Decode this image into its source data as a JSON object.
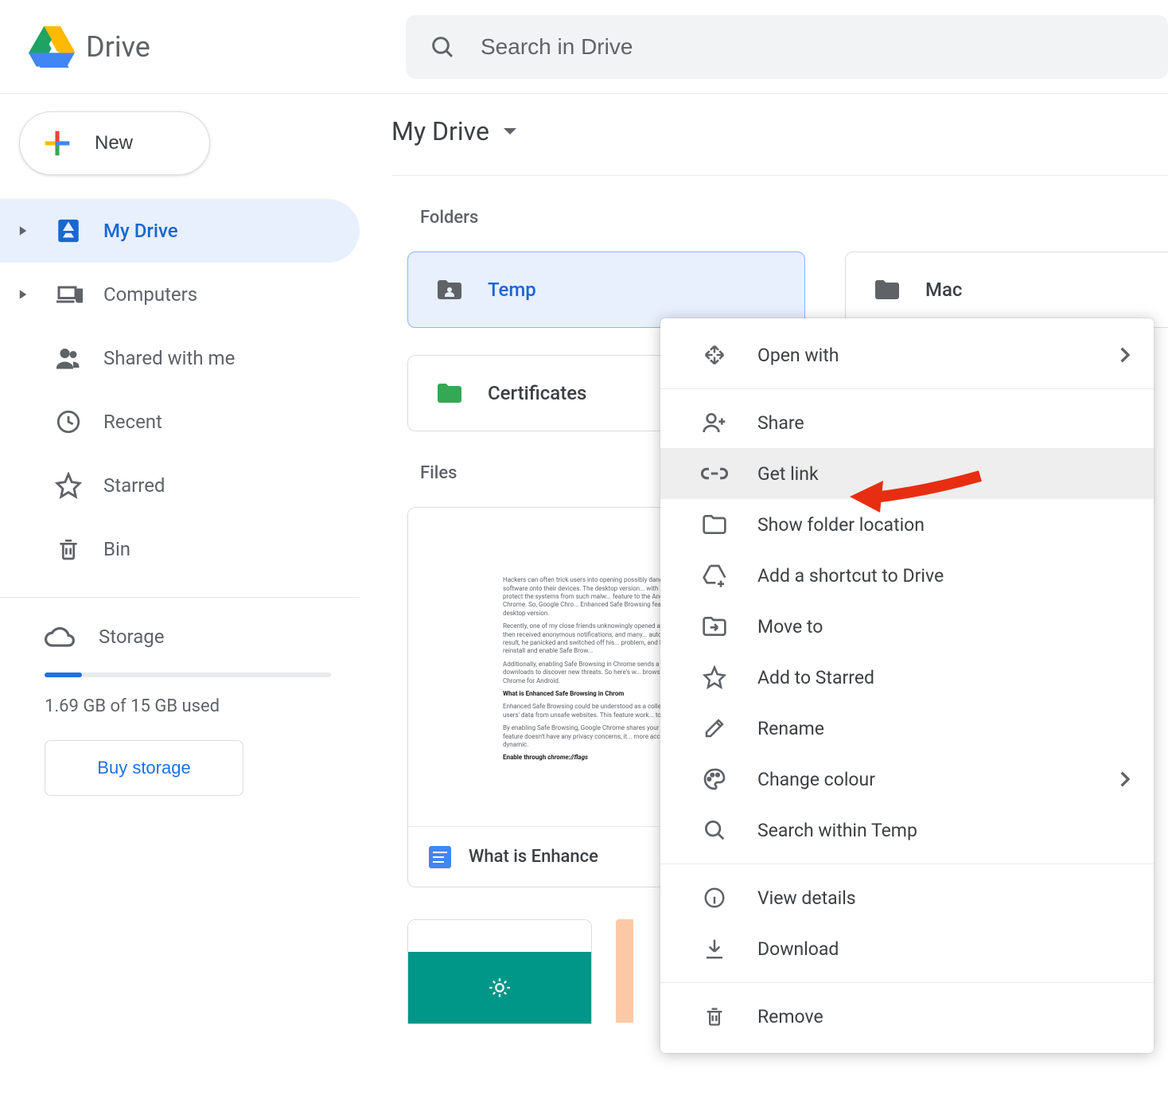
{
  "header": {
    "app_name": "Drive",
    "search_placeholder": "Search in Drive"
  },
  "sidebar": {
    "new_label": "New",
    "items": [
      {
        "label": "My Drive"
      },
      {
        "label": "Computers"
      },
      {
        "label": "Shared with me"
      },
      {
        "label": "Recent"
      },
      {
        "label": "Starred"
      },
      {
        "label": "Bin"
      }
    ],
    "storage_label": "Storage",
    "storage_text": "1.69 GB of 15 GB used",
    "buy_label": "Buy storage"
  },
  "breadcrumb": {
    "title": "My Drive"
  },
  "sections": {
    "folders_label": "Folders",
    "files_label": "Files"
  },
  "folders": [
    {
      "name": "Temp"
    },
    {
      "name": "Mac"
    },
    {
      "name": "Certificates"
    }
  ],
  "files": [
    {
      "name": "What is Enhance"
    }
  ],
  "doc_preview": {
    "p1": "Hackers can often trick users into opening possibly danger... malicious software onto their devices. The desktop version... with Safe Browsing to protect the systems from such malw... feature to the Android version of Chrome. So, Google Chro... Enhanced Safe Browsing feature as the desktop version.",
    "p2": "Recently, one of my close friends unknowingly opened a m... web. He then received anonymous notifications, and many... automatically. As a result, he panicked and switched off his... problem, and I suggested he reinstall and enable Safe Brow...",
    "p3": "Additionally, enabling Safe Browsing in Chrome sends a s... pages and downloads to discover new threats. So here's w... browsing on Google Chrome for Android.",
    "h1": "What is Enhanced Safe Browsing in Chrom",
    "p4": "Enhanced Safe Browsing could be understood as a collect... secure users' data from unsafe websites. This feature work... tools.",
    "p5": "By enabling Safe Browsing, Google Chrome shares your b... Although this feature doesn't have any privacy concerns, it... more accurate and dynamic.",
    "h2a": "Enable through ",
    "h2b": "chrome://flags"
  },
  "context_menu": {
    "open_with": "Open with",
    "share": "Share",
    "get_link": "Get link",
    "show_folder": "Show folder location",
    "add_shortcut": "Add a shortcut to Drive",
    "move_to": "Move to",
    "add_starred": "Add to Starred",
    "rename": "Rename",
    "change_colour": "Change colour",
    "search_within": "Search within Temp",
    "view_details": "View details",
    "download": "Download",
    "remove": "Remove"
  }
}
